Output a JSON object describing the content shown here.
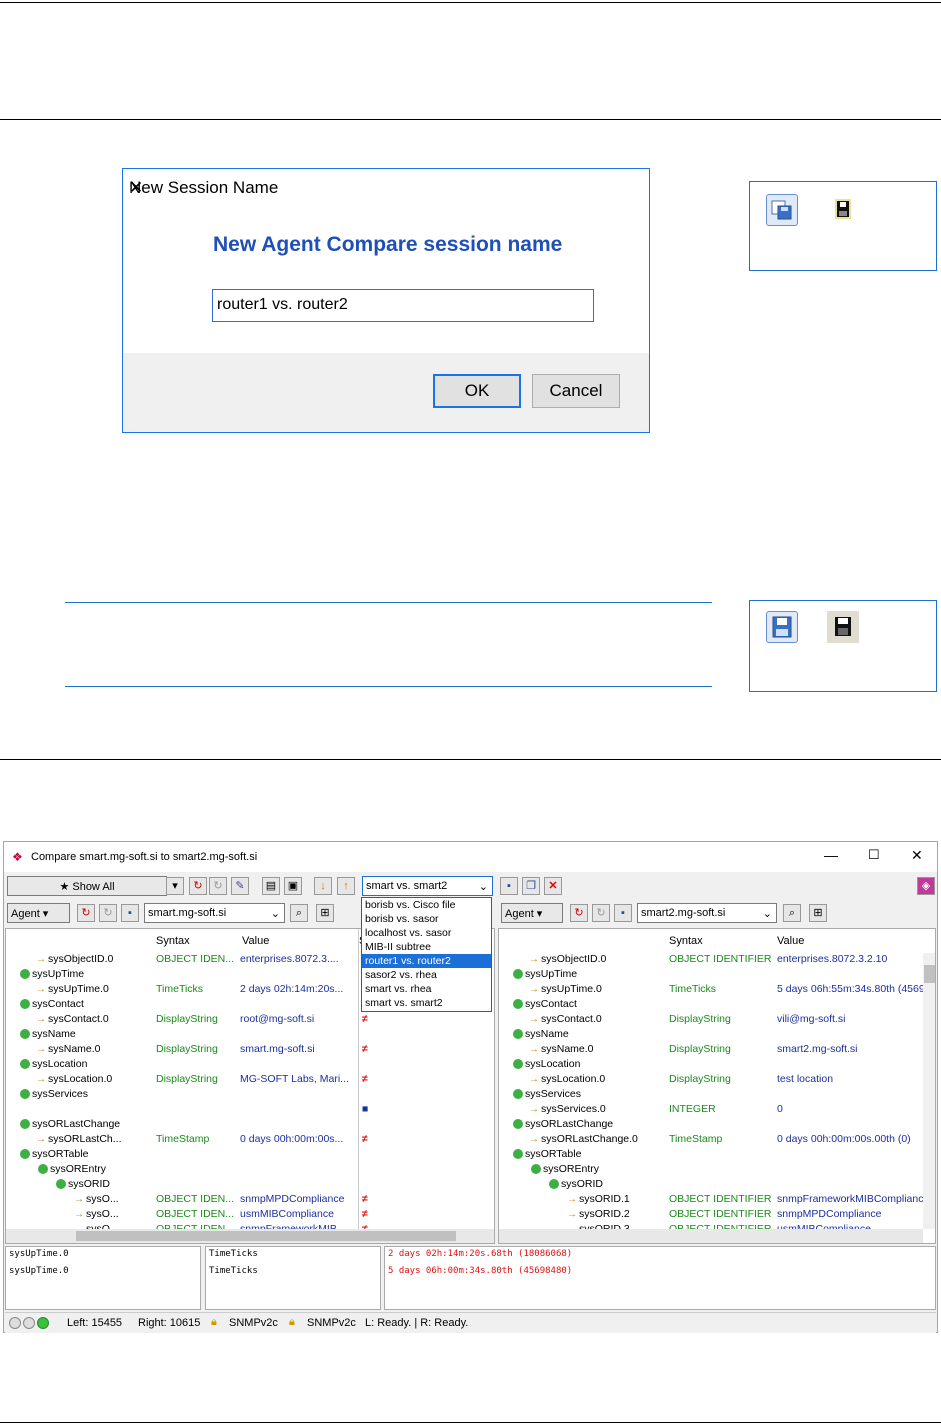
{
  "dialog": {
    "title": "New Session Name",
    "close_glyph": "✕",
    "heading": "New Agent Compare session name",
    "input_value": "router1 vs. router2",
    "ok_label": "OK",
    "cancel_label": "Cancel"
  },
  "window": {
    "title": "Compare smart.mg-soft.si to smart2.mg-soft.si",
    "show_all": "Show All",
    "session_combo": "smart vs. smart2",
    "sessions": [
      "borisb vs. Cisco file",
      "borisb vs. sasor",
      "localhost vs. sasor",
      "MIB-II subtree",
      "router1 vs. router2",
      "sasor2 vs. rhea",
      "smart vs. rhea",
      "smart vs. smart2"
    ],
    "selected_session_index": 4,
    "agent_label": "Agent",
    "left_agent": "smart.mg-soft.si",
    "right_agent": "smart2.mg-soft.si",
    "col_syntax": "Syntax",
    "col_value": "Value",
    "col_s": "S",
    "left_rows": [
      {
        "name": "sysObjectID.0",
        "syntax": "OBJECT IDEN...",
        "value": "enterprises.8072.3....",
        "diff": "="
      },
      {
        "name": "sysUpTime",
        "syntax": "",
        "value": "",
        "diff": ""
      },
      {
        "name": "sysUpTime.0",
        "syntax": "TimeTicks",
        "value": "2 days 02h:14m:20s...",
        "diff": "≠"
      },
      {
        "name": "sysContact",
        "syntax": "",
        "value": "",
        "diff": ""
      },
      {
        "name": "sysContact.0",
        "syntax": "DisplayString",
        "value": "root@mg-soft.si",
        "diff": "≠"
      },
      {
        "name": "sysName",
        "syntax": "",
        "value": "",
        "diff": ""
      },
      {
        "name": "sysName.0",
        "syntax": "DisplayString",
        "value": "smart.mg-soft.si",
        "diff": "≠"
      },
      {
        "name": "sysLocation",
        "syntax": "",
        "value": "",
        "diff": ""
      },
      {
        "name": "sysLocation.0",
        "syntax": "DisplayString",
        "value": "MG-SOFT Labs, Mari...",
        "diff": "≠"
      },
      {
        "name": "sysServices",
        "syntax": "",
        "value": "",
        "diff": ""
      },
      {
        "name": "",
        "syntax": "",
        "value": "",
        "diff": "■"
      },
      {
        "name": "sysORLastChange",
        "syntax": "",
        "value": "",
        "diff": ""
      },
      {
        "name": "sysORLastCh...",
        "syntax": "TimeStamp",
        "value": "0 days 00h:00m:00s...",
        "diff": "≠"
      },
      {
        "name": "sysORTable",
        "syntax": "",
        "value": "",
        "diff": ""
      },
      {
        "name": "sysOREntry",
        "syntax": "",
        "value": "",
        "diff": ""
      },
      {
        "name": "sysORID",
        "syntax": "",
        "value": "",
        "diff": ""
      },
      {
        "name": "sysO...",
        "syntax": "OBJECT IDEN...",
        "value": "snmpMPDCompliance",
        "diff": "≠"
      },
      {
        "name": "sysO...",
        "syntax": "OBJECT IDEN...",
        "value": "usmMIBCompliance",
        "diff": "≠"
      },
      {
        "name": "sysO...",
        "syntax": "OBJECT IDEN...",
        "value": "snmpFrameworkMIB...",
        "diff": "≠"
      }
    ],
    "right_rows": [
      {
        "name": "sysObjectID.0",
        "syntax": "OBJECT IDENTIFIER",
        "value": "enterprises.8072.3.2.10"
      },
      {
        "name": "sysUpTime",
        "syntax": "",
        "value": ""
      },
      {
        "name": "sysUpTime.0",
        "syntax": "TimeTicks",
        "value": "5 days 06h:55m:34s.80th (4569"
      },
      {
        "name": "sysContact",
        "syntax": "",
        "value": ""
      },
      {
        "name": "sysContact.0",
        "syntax": "DisplayString",
        "value": "vili@mg-soft.si"
      },
      {
        "name": "sysName",
        "syntax": "",
        "value": ""
      },
      {
        "name": "sysName.0",
        "syntax": "DisplayString",
        "value": "smart2.mg-soft.si"
      },
      {
        "name": "sysLocation",
        "syntax": "",
        "value": ""
      },
      {
        "name": "sysLocation.0",
        "syntax": "DisplayString",
        "value": "test location"
      },
      {
        "name": "sysServices",
        "syntax": "",
        "value": ""
      },
      {
        "name": "sysServices.0",
        "syntax": "INTEGER",
        "value": "0"
      },
      {
        "name": "sysORLastChange",
        "syntax": "",
        "value": ""
      },
      {
        "name": "sysORLastChange.0",
        "syntax": "TimeStamp",
        "value": "0 days 00h:00m:00s.00th (0)"
      },
      {
        "name": "sysORTable",
        "syntax": "",
        "value": ""
      },
      {
        "name": "sysOREntry",
        "syntax": "",
        "value": ""
      },
      {
        "name": "sysORID",
        "syntax": "",
        "value": ""
      },
      {
        "name": "sysORID.1",
        "syntax": "OBJECT IDENTIFIER",
        "value": "snmpFrameworkMIBCompliance"
      },
      {
        "name": "sysORID.2",
        "syntax": "OBJECT IDENTIFIER",
        "value": "snmpMPDCompliance"
      },
      {
        "name": "sysORID.3",
        "syntax": "OBJECT IDENTIFIER",
        "value": "usmMIBCompliance"
      }
    ],
    "detail": [
      {
        "name": "sysUpTime.0",
        "syntax": "TimeTicks",
        "value": "2 days 02h:14m:20s.68th (18086068)"
      },
      {
        "name": "sysUpTime.0",
        "syntax": "TimeTicks",
        "value": "5 days 06h:00m:34s.80th (45698480)"
      }
    ],
    "status": {
      "left": "Left: 15455",
      "right": "Right: 10615",
      "snmp1": "SNMPv2c",
      "snmp2": "SNMPv2c",
      "ready": "L: Ready. | R: Ready."
    }
  },
  "colors": {
    "accent": "#1f4fb8",
    "selection": "#1c6fd6",
    "diff": "#e01010",
    "syntax": "#1a8a1a",
    "value": "#1b2f9e"
  }
}
